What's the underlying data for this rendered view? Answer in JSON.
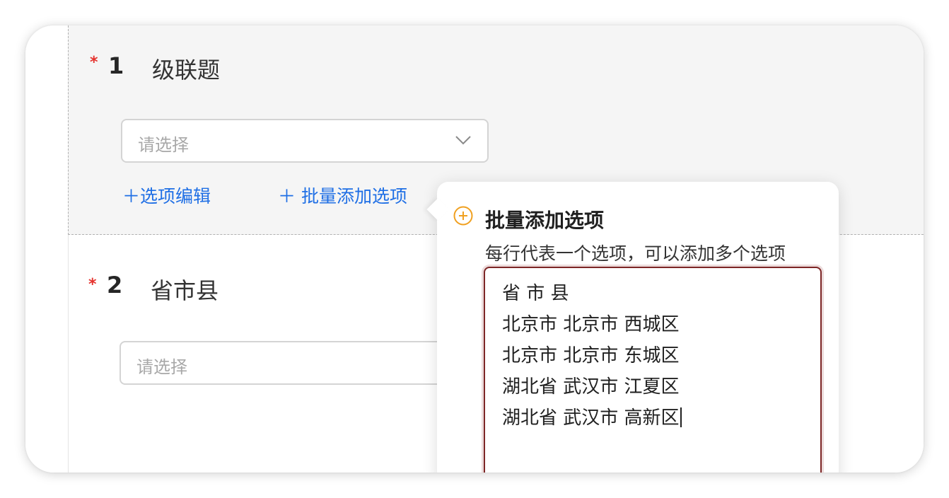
{
  "question1": {
    "required_mark": "*",
    "number": "1",
    "title": "级联题",
    "select_placeholder": "请选择",
    "action_edit": "＋选项编辑",
    "action_batch": "＋ 批量添加选项"
  },
  "question2": {
    "required_mark": "*",
    "number": "2",
    "title": "省市县",
    "select_placeholder": "请选择"
  },
  "popover": {
    "title": "批量添加选项",
    "description": "每行代表一个选项，可以添加多个选项",
    "icon": "plus-circle-icon",
    "icon_color": "#f0a020",
    "lines": [
      "省 市 县",
      "北京市 北京市 西城区",
      "北京市 北京市 东城区",
      "湖北省 武汉市 江夏区",
      "湖北省 武汉市 高新区"
    ]
  },
  "colors": {
    "accent_link": "#1f6fe5",
    "required": "#e5322d",
    "textarea_border": "#7d2626"
  }
}
